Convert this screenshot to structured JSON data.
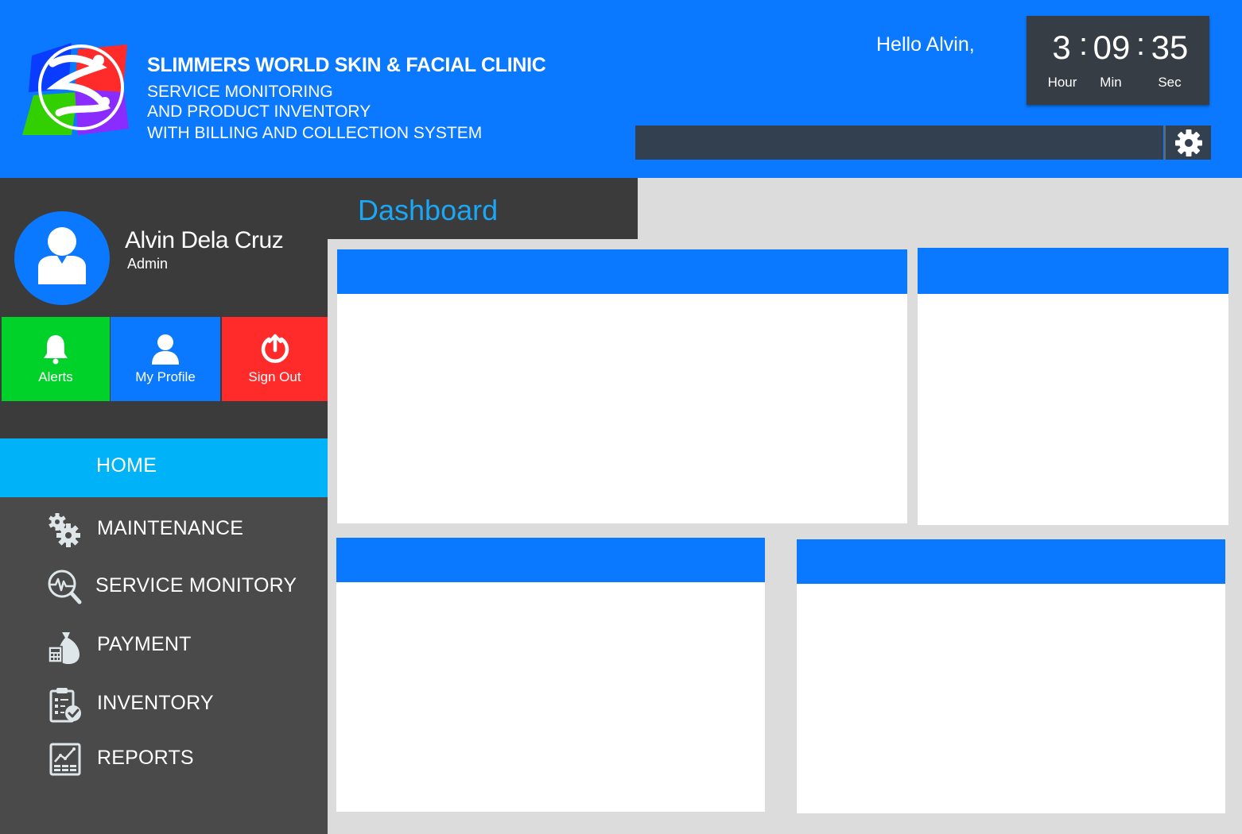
{
  "brand": {
    "title": "SLIMMERS WORLD  SKIN & FACIAL CLINIC",
    "subtitle_lines": [
      "SERVICE MONITORING",
      "AND PRODUCT INVENTORY",
      "WITH BILLING AND COLLECTION SYSTEM"
    ]
  },
  "header": {
    "greeting": "Hello Alvin,",
    "clock": {
      "hour": "3",
      "min": "09",
      "sec": "35",
      "hour_label": "Hour",
      "min_label": "Min",
      "sec_label": "Sec"
    },
    "search": {
      "value": ""
    },
    "settings_icon": "gear-icon"
  },
  "user": {
    "name": "Alvin Dela Cruz",
    "role": "Admin"
  },
  "quick_actions": [
    {
      "label": "Alerts",
      "icon": "bell-icon",
      "color": "#00d22a"
    },
    {
      "label": "My Profile",
      "icon": "user-icon",
      "color": "#0a78ff"
    },
    {
      "label": "Sign Out",
      "icon": "power-icon",
      "color": "#ff2b2b"
    }
  ],
  "page_title": "Dashboard",
  "nav": {
    "home": "HOME",
    "items": [
      {
        "label": "MAINTENANCE",
        "icon": "gears-icon"
      },
      {
        "label": "SERVICE MONITORY",
        "icon": "monitor-search-icon"
      },
      {
        "label": "PAYMENT",
        "icon": "money-bag-calculator-icon"
      },
      {
        "label": "INVENTORY",
        "icon": "clipboard-check-icon"
      },
      {
        "label": "REPORTS",
        "icon": "chart-report-icon"
      }
    ]
  },
  "colors": {
    "brand_blue": "#0a78ff",
    "active_nav": "#00b2f8",
    "sidebar": "#4a4a4a",
    "dark_panel": "#3b3b3b",
    "title_blue": "#1aa7f5"
  }
}
